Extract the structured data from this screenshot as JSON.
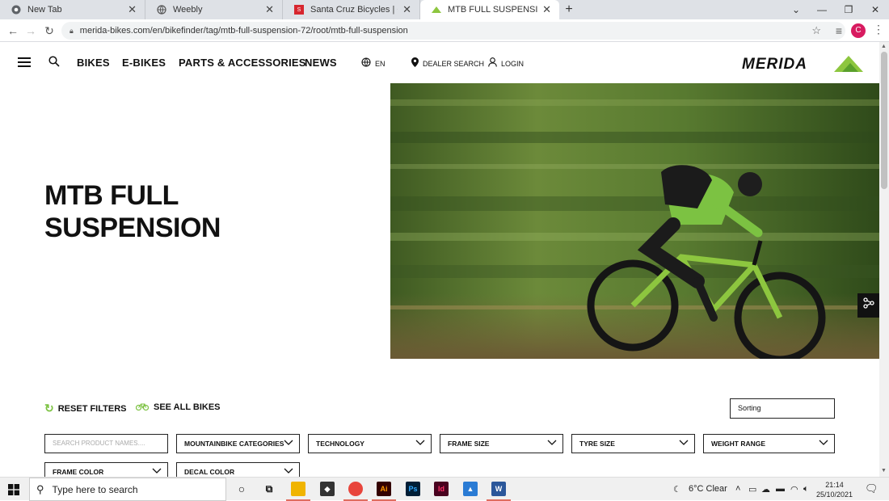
{
  "browser": {
    "tabs": [
      {
        "title": "New Tab",
        "icon": "chrome-icon"
      },
      {
        "title": "Weebly",
        "icon": "globe-icon"
      },
      {
        "title": "Santa Cruz Bicycles | Quality Bicy",
        "icon": "santa-cruz-icon"
      },
      {
        "title": "MTB FULL SUSPENSION - MERID",
        "icon": "merida-icon",
        "active": true
      }
    ],
    "url": "merida-bikes.com/en/bikefinder/tag/mtb-full-suspension-72/root/mtb-full-suspension",
    "profile_initial": "C"
  },
  "header": {
    "nav": [
      "BIKES",
      "E-BIKES",
      "PARTS & ACCESSORIES",
      "NEWS"
    ],
    "language": "EN",
    "dealer_search": "DEALER SEARCH",
    "login": "LOGIN",
    "logo_text": "MERIDA",
    "brand_color": "#8dc63f"
  },
  "hero": {
    "title_line1": "MTB FULL",
    "title_line2": "SUSPENSION"
  },
  "filters": {
    "reset_label": "RESET FILTERS",
    "see_all_label": "SEE ALL BIKES",
    "sorting_label": "Sorting",
    "search_placeholder": "SEARCH PRODUCT NAMES....",
    "dropdowns": [
      "MOUNTAINBIKE CATEGORIES",
      "TECHNOLOGY",
      "FRAME SIZE",
      "TYRE SIZE",
      "WEIGHT RANGE",
      "FRAME COLOR",
      "DECAL COLOR"
    ]
  },
  "taskbar": {
    "search_placeholder": "Type here to search",
    "weather": "6°C  Clear",
    "time": "21:14",
    "date": "25/10/2021"
  }
}
